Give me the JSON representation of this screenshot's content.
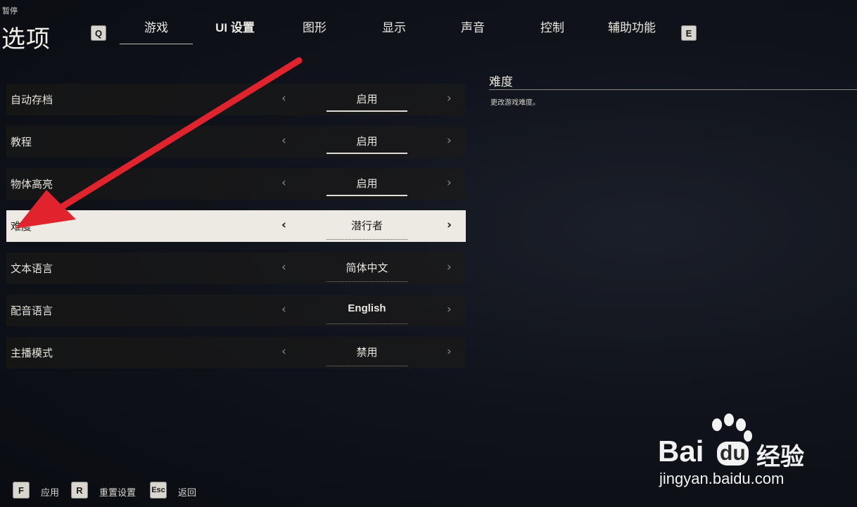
{
  "header": {
    "pause": "暂停",
    "title": "选项",
    "key_prev": "Q",
    "key_next": "E"
  },
  "tabs": [
    {
      "label": "游戏"
    },
    {
      "label": "UI 设置"
    },
    {
      "label": "图形"
    },
    {
      "label": "显示"
    },
    {
      "label": "声音"
    },
    {
      "label": "控制"
    },
    {
      "label": "辅助功能"
    }
  ],
  "settings": [
    {
      "label": "自动存档",
      "value": "启用"
    },
    {
      "label": "教程",
      "value": "启用"
    },
    {
      "label": "物体高亮",
      "value": "启用"
    },
    {
      "label": "难度",
      "value": "潜行者"
    },
    {
      "label": "文本语言",
      "value": "简体中文"
    },
    {
      "label": "配音语言",
      "value": "English"
    },
    {
      "label": "主播模式",
      "value": "禁用"
    }
  ],
  "description": {
    "title": "难度",
    "text": "更改游戏难度。"
  },
  "footer": [
    {
      "key": "F",
      "label": "应用"
    },
    {
      "key": "R",
      "label": "重置设置"
    },
    {
      "key": "Esc",
      "label": "返回"
    }
  ],
  "arrows": {
    "left": "‹",
    "right": "›"
  },
  "watermark": {
    "brand_a": "Bai",
    "brand_b": "du",
    "brand_cn": "经验",
    "url": "jingyan.baidu.com"
  },
  "colors": {
    "annotation_arrow": "#e0232d",
    "selected_row": "#edeae3"
  }
}
